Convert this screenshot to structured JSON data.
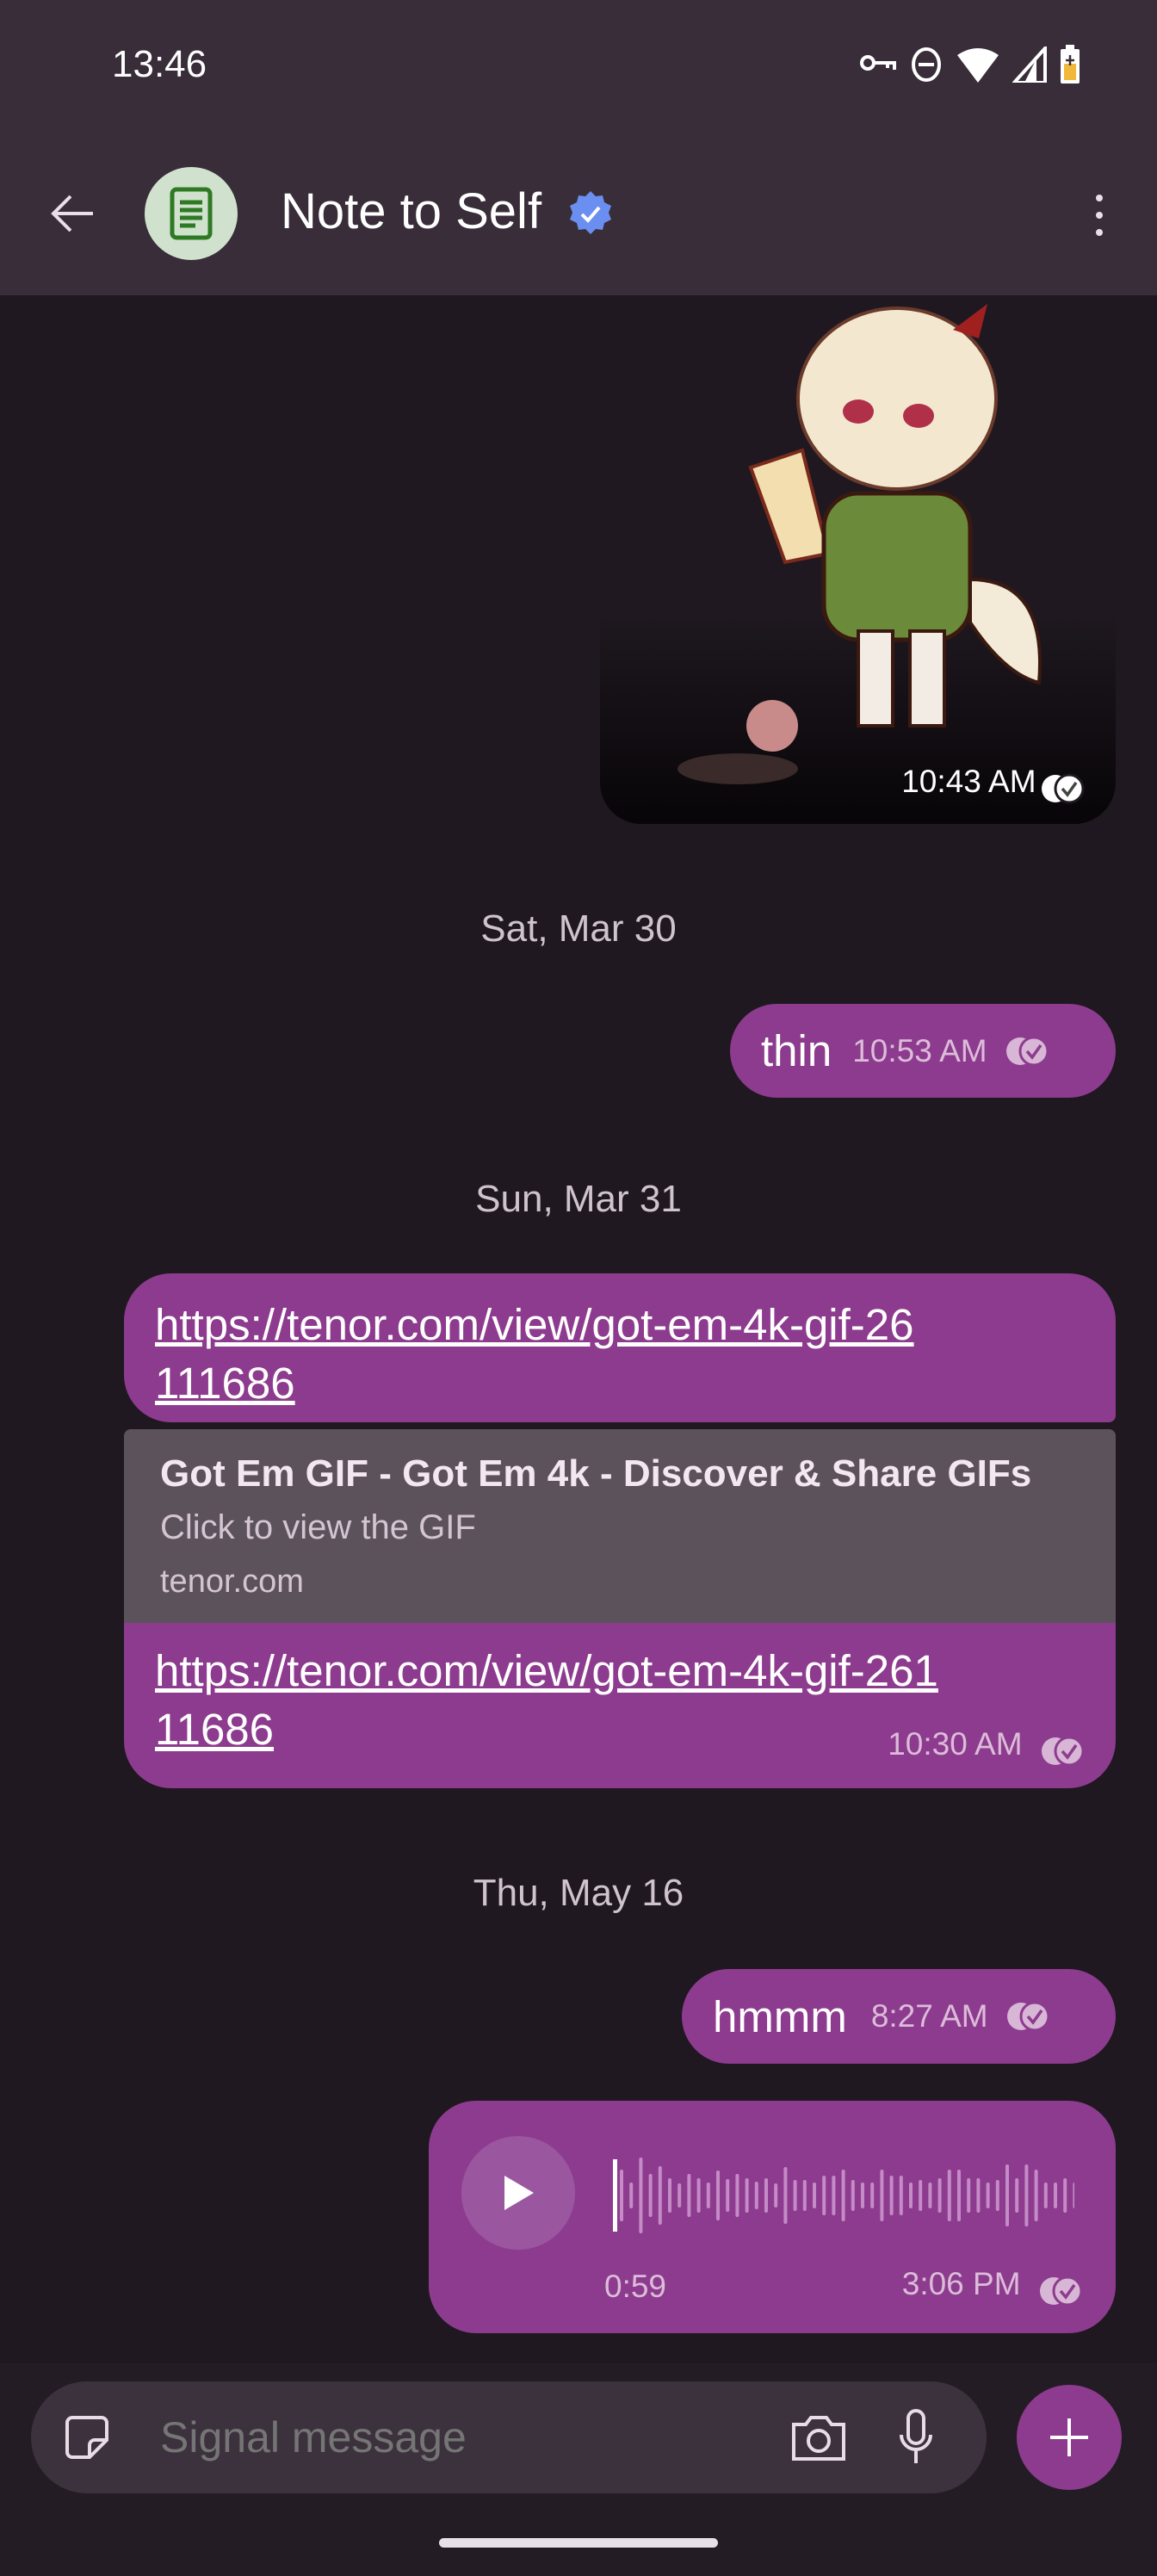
{
  "status_bar": {
    "time": "13:46",
    "icons": [
      "vpn-key-icon",
      "do-not-disturb-icon",
      "wifi-icon",
      "cell-signal-icon",
      "battery-charging-icon"
    ]
  },
  "header": {
    "title": "Note to Self",
    "verified": true,
    "avatar_icon": "note-icon",
    "back_icon": "arrow-left-icon",
    "menu_icon": "more-vertical-icon"
  },
  "colors": {
    "bubble": "#8d3b8e",
    "background": "#1f1820",
    "header": "#382d38",
    "preview": "#5c525c",
    "verified": "#6b8ff0"
  },
  "messages": [
    {
      "type": "sticker",
      "time": "10:43 AM",
      "status": "read"
    },
    {
      "type": "date",
      "label": "Sat, Mar 30"
    },
    {
      "type": "text",
      "text": "thin",
      "time": "10:53 AM",
      "status": "read"
    },
    {
      "type": "date",
      "label": "Sun, Mar 31"
    },
    {
      "type": "link",
      "url_top": "https://tenor.com/view/got-em-4k-gif-26111686",
      "preview": {
        "title": "Got Em GIF - Got Em 4k - Discover & Share GIFs",
        "description": "Click to view the GIF",
        "domain": "tenor.com"
      },
      "url": "https://tenor.com/view/got-em-4k-gif-26111686",
      "time": "10:30 AM",
      "status": "read"
    },
    {
      "type": "date",
      "label": "Thu, May 16"
    },
    {
      "type": "text",
      "text": "hmmm",
      "time": "8:27 AM",
      "status": "read"
    },
    {
      "type": "voice",
      "duration": "0:59",
      "progress": 0,
      "time": "3:06 PM",
      "status": "read"
    }
  ],
  "composer": {
    "placeholder": "Signal message",
    "sticker_icon": "sticker-icon",
    "camera_icon": "camera-icon",
    "mic_icon": "microphone-icon",
    "attach_icon": "plus-icon"
  }
}
